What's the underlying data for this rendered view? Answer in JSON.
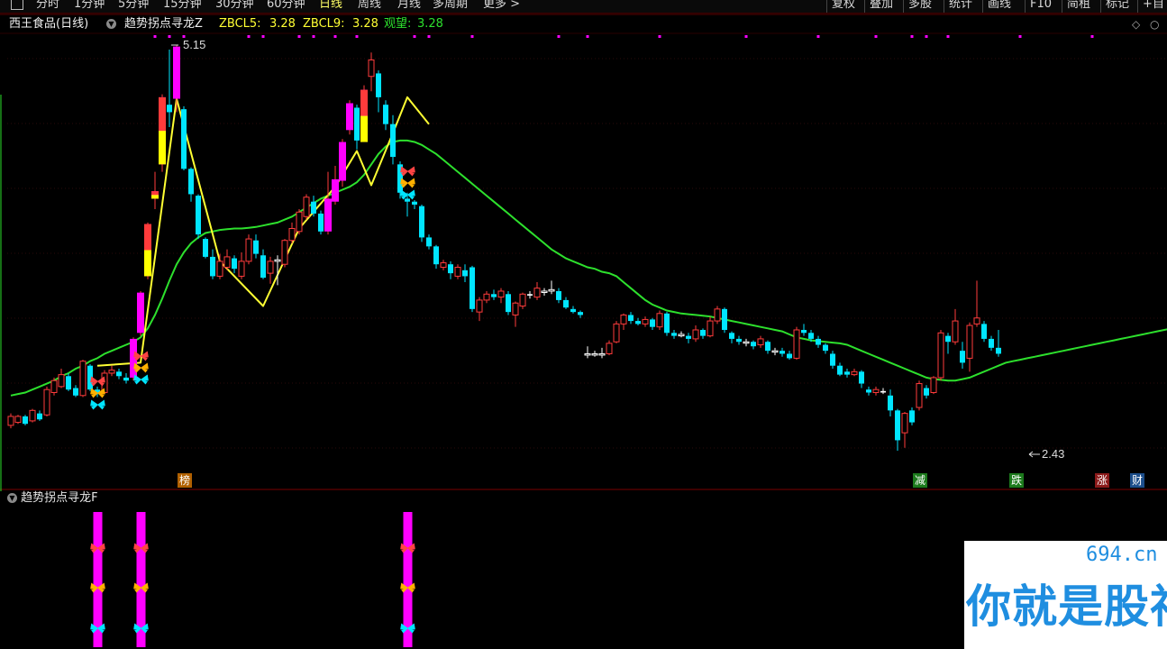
{
  "toolbar": {
    "left_items": [
      "分时",
      "1分钟",
      "5分钟",
      "15分钟",
      "30分钟",
      "60分钟",
      "日线",
      "周线",
      "月线",
      "多周期",
      "更多 >"
    ],
    "active_index": 6,
    "right_items": [
      "复权",
      "叠加",
      "多股",
      "统计",
      "画线",
      "F10",
      "简租",
      "标记",
      "+自"
    ]
  },
  "header": {
    "stock": "西王食品(日线)",
    "indicator": "趋势拐点寻龙Z",
    "zbcl5_label": "ZBCL5:",
    "zbcl5_value": "3.28",
    "zbcl9_label": "ZBCL9:",
    "zbcl9_value": "3.28",
    "watch_label": "观望:",
    "watch_value": "3.28"
  },
  "price_labels": {
    "high": "5.15",
    "low": "2.43"
  },
  "events": [
    {
      "label": "榜",
      "color": "#b06000"
    },
    {
      "label": "减",
      "color": "#1c7a1c"
    },
    {
      "label": "跌",
      "color": "#1c7a1c"
    },
    {
      "label": "涨",
      "color": "#8b1a1a"
    },
    {
      "label": "财",
      "color": "#1c4e8b"
    }
  ],
  "sub_panel": {
    "title": "趋势拐点寻龙F"
  },
  "colors": {
    "up": "#ff3b3b",
    "down": "#00e5ff",
    "ma": "#2de02d",
    "trend": "#ffff33",
    "signal": "#ff00ff"
  },
  "watermark": {
    "site": "694.cn",
    "text": "你就是股神"
  },
  "chart_data": {
    "type": "candlestick",
    "title": "",
    "y_range": [
      2.3,
      5.3
    ],
    "candles": [
      {
        "o": 2.6,
        "c": 2.66,
        "h": 2.68,
        "l": 2.58
      },
      {
        "o": 2.62,
        "c": 2.66,
        "h": 2.67,
        "l": 2.61
      },
      {
        "o": 2.66,
        "c": 2.61,
        "h": 2.67,
        "l": 2.6
      },
      {
        "o": 2.63,
        "c": 2.7,
        "h": 2.71,
        "l": 2.62
      },
      {
        "o": 2.68,
        "c": 2.64,
        "h": 2.7,
        "l": 2.63
      },
      {
        "o": 2.67,
        "c": 2.84,
        "h": 2.86,
        "l": 2.66
      },
      {
        "o": 2.82,
        "c": 2.9,
        "h": 2.92,
        "l": 2.8
      },
      {
        "o": 2.86,
        "c": 2.94,
        "h": 2.98,
        "l": 2.85
      },
      {
        "o": 2.93,
        "c": 2.84,
        "h": 2.95,
        "l": 2.83
      },
      {
        "o": 2.85,
        "c": 2.8,
        "h": 2.87,
        "l": 2.79
      },
      {
        "o": 2.8,
        "c": 3.03,
        "h": 3.04,
        "l": 2.79
      },
      {
        "o": 3.0,
        "c": 2.84,
        "h": 3.01,
        "l": 2.83
      },
      {
        "o": 2.84,
        "c": 2.81,
        "h": 2.86,
        "l": 2.79
      },
      {
        "o": 2.82,
        "c": 2.95,
        "h": 2.97,
        "l": 2.81
      },
      {
        "o": 2.95,
        "c": 2.97,
        "h": 3.0,
        "l": 2.93
      },
      {
        "o": 2.96,
        "c": 2.93,
        "h": 2.98,
        "l": 2.91
      },
      {
        "o": 2.92,
        "c": 2.9,
        "h": 2.95,
        "l": 2.88
      },
      {
        "o": 2.92,
        "c": 3.18,
        "h": 3.19,
        "l": 2.9
      },
      {
        "o": 3.22,
        "c": 3.49,
        "h": 3.5,
        "l": 3.2
      },
      {
        "o": 3.6,
        "c": 3.95,
        "h": 3.96,
        "l": 3.58
      },
      {
        "o": 4.12,
        "c": 4.17,
        "h": 4.3,
        "l": 4.05
      },
      {
        "o": 4.35,
        "c": 4.8,
        "h": 4.82,
        "l": 4.3
      },
      {
        "o": 4.75,
        "c": 4.7,
        "h": 5.12,
        "l": 4.6
      },
      {
        "o": 4.79,
        "c": 5.14,
        "h": 5.15,
        "l": 4.7
      },
      {
        "o": 4.72,
        "c": 4.32,
        "h": 4.74,
        "l": 4.31
      },
      {
        "o": 4.32,
        "c": 4.15,
        "h": 4.33,
        "l": 4.1
      },
      {
        "o": 4.14,
        "c": 3.88,
        "h": 4.15,
        "l": 3.85
      },
      {
        "o": 3.85,
        "c": 3.73,
        "h": 3.86,
        "l": 3.72
      },
      {
        "o": 3.73,
        "c": 3.6,
        "h": 3.78,
        "l": 3.58
      },
      {
        "o": 3.6,
        "c": 3.7,
        "h": 3.75,
        "l": 3.58
      },
      {
        "o": 3.66,
        "c": 3.73,
        "h": 3.78,
        "l": 3.64
      },
      {
        "o": 3.72,
        "c": 3.65,
        "h": 3.74,
        "l": 3.62
      },
      {
        "o": 3.6,
        "c": 3.7,
        "h": 3.76,
        "l": 3.58
      },
      {
        "o": 3.7,
        "c": 3.85,
        "h": 3.88,
        "l": 3.68
      },
      {
        "o": 3.84,
        "c": 3.75,
        "h": 3.88,
        "l": 3.72
      },
      {
        "o": 3.74,
        "c": 3.59,
        "h": 3.78,
        "l": 3.58
      },
      {
        "o": 3.62,
        "c": 3.7,
        "h": 3.73,
        "l": 3.55
      },
      {
        "o": 3.7,
        "c": 3.71,
        "h": 3.74,
        "l": 3.54
      },
      {
        "o": 3.68,
        "c": 3.84,
        "h": 3.85,
        "l": 3.66
      },
      {
        "o": 3.84,
        "c": 3.92,
        "h": 3.96,
        "l": 3.82
      },
      {
        "o": 3.9,
        "c": 4.03,
        "h": 4.05,
        "l": 3.88
      },
      {
        "o": 4.0,
        "c": 4.13,
        "h": 4.15,
        "l": 3.98
      },
      {
        "o": 4.1,
        "c": 4.02,
        "h": 4.14,
        "l": 4.0
      },
      {
        "o": 4.02,
        "c": 3.9,
        "h": 4.04,
        "l": 3.88
      },
      {
        "o": 3.9,
        "c": 4.12,
        "h": 4.3,
        "l": 3.88
      },
      {
        "o": 4.1,
        "c": 4.25,
        "h": 4.34,
        "l": 4.08
      },
      {
        "o": 4.24,
        "c": 4.5,
        "h": 4.52,
        "l": 4.2
      },
      {
        "o": 4.58,
        "c": 4.76,
        "h": 4.78,
        "l": 4.55
      },
      {
        "o": 4.73,
        "c": 4.51,
        "h": 4.75,
        "l": 4.45
      },
      {
        "o": 4.5,
        "c": 4.85,
        "h": 4.88,
        "l": 4.5
      },
      {
        "o": 4.94,
        "c": 5.05,
        "h": 5.1,
        "l": 4.84
      },
      {
        "o": 4.96,
        "c": 4.8,
        "h": 4.98,
        "l": 4.7
      },
      {
        "o": 4.75,
        "c": 4.62,
        "h": 4.78,
        "l": 4.58
      },
      {
        "o": 4.62,
        "c": 4.4,
        "h": 4.68,
        "l": 4.35
      },
      {
        "o": 4.35,
        "c": 4.16,
        "h": 4.37,
        "l": 4.12
      },
      {
        "o": 4.12,
        "c": 4.1,
        "h": 4.16,
        "l": 4.0
      },
      {
        "o": 4.1,
        "c": 4.08,
        "h": 4.11,
        "l": 4.05
      },
      {
        "o": 4.07,
        "c": 3.86,
        "h": 4.08,
        "l": 3.83
      },
      {
        "o": 3.86,
        "c": 3.8,
        "h": 3.88,
        "l": 3.78
      },
      {
        "o": 3.8,
        "c": 3.68,
        "h": 3.81,
        "l": 3.65
      },
      {
        "o": 3.66,
        "c": 3.69,
        "h": 3.71,
        "l": 3.64
      },
      {
        "o": 3.68,
        "c": 3.62,
        "h": 3.7,
        "l": 3.58
      },
      {
        "o": 3.6,
        "c": 3.66,
        "h": 3.68,
        "l": 3.58
      },
      {
        "o": 3.64,
        "c": 3.6,
        "h": 3.68,
        "l": 3.56
      },
      {
        "o": 3.66,
        "c": 3.38,
        "h": 3.67,
        "l": 3.36
      },
      {
        "o": 3.36,
        "c": 3.44,
        "h": 3.46,
        "l": 3.3
      },
      {
        "o": 3.44,
        "c": 3.48,
        "h": 3.5,
        "l": 3.42
      },
      {
        "o": 3.48,
        "c": 3.46,
        "h": 3.51,
        "l": 3.44
      },
      {
        "o": 3.46,
        "c": 3.5,
        "h": 3.52,
        "l": 3.42
      },
      {
        "o": 3.48,
        "c": 3.36,
        "h": 3.5,
        "l": 3.34
      },
      {
        "o": 3.34,
        "c": 3.42,
        "h": 3.43,
        "l": 3.26
      },
      {
        "o": 3.4,
        "c": 3.48,
        "h": 3.49,
        "l": 3.38
      },
      {
        "o": 3.48,
        "c": 3.47,
        "h": 3.5,
        "l": 3.45
      },
      {
        "o": 3.46,
        "c": 3.52,
        "h": 3.56,
        "l": 3.44
      },
      {
        "o": 3.5,
        "c": 3.5,
        "h": 3.52,
        "l": 3.47
      },
      {
        "o": 3.5,
        "c": 3.51,
        "h": 3.57,
        "l": 3.48
      },
      {
        "o": 3.5,
        "c": 3.44,
        "h": 3.52,
        "l": 3.42
      },
      {
        "o": 3.44,
        "c": 3.39,
        "h": 3.46,
        "l": 3.38
      },
      {
        "o": 3.38,
        "c": 3.36,
        "h": 3.4,
        "l": 3.35
      },
      {
        "o": 3.36,
        "c": 3.34,
        "h": 3.37,
        "l": 3.32
      },
      {
        "o": 3.08,
        "c": 3.08,
        "h": 3.13,
        "l": 3.05
      },
      {
        "o": 3.08,
        "c": 3.08,
        "h": 3.1,
        "l": 3.06
      },
      {
        "o": 3.08,
        "c": 3.08,
        "h": 3.12,
        "l": 3.05
      },
      {
        "o": 3.08,
        "c": 3.15,
        "h": 3.17,
        "l": 3.07
      },
      {
        "o": 3.16,
        "c": 3.28,
        "h": 3.3,
        "l": 3.15
      },
      {
        "o": 3.28,
        "c": 3.34,
        "h": 3.35,
        "l": 3.24
      },
      {
        "o": 3.34,
        "c": 3.3,
        "h": 3.36,
        "l": 3.28
      },
      {
        "o": 3.3,
        "c": 3.28,
        "h": 3.32,
        "l": 3.27
      },
      {
        "o": 3.28,
        "c": 3.31,
        "h": 3.33,
        "l": 3.26
      },
      {
        "o": 3.31,
        "c": 3.26,
        "h": 3.32,
        "l": 3.24
      },
      {
        "o": 3.26,
        "c": 3.35,
        "h": 3.37,
        "l": 3.24
      },
      {
        "o": 3.35,
        "c": 3.22,
        "h": 3.36,
        "l": 3.2
      },
      {
        "o": 3.22,
        "c": 3.2,
        "h": 3.24,
        "l": 3.18
      },
      {
        "o": 3.2,
        "c": 3.21,
        "h": 3.23,
        "l": 3.19
      },
      {
        "o": 3.2,
        "c": 3.18,
        "h": 3.22,
        "l": 3.15
      },
      {
        "o": 3.18,
        "c": 3.24,
        "h": 3.27,
        "l": 3.16
      },
      {
        "o": 3.24,
        "c": 3.2,
        "h": 3.25,
        "l": 3.18
      },
      {
        "o": 3.2,
        "c": 3.3,
        "h": 3.33,
        "l": 3.19
      },
      {
        "o": 3.3,
        "c": 3.38,
        "h": 3.4,
        "l": 3.28
      },
      {
        "o": 3.38,
        "c": 3.24,
        "h": 3.39,
        "l": 3.22
      },
      {
        "o": 3.22,
        "c": 3.18,
        "h": 3.23,
        "l": 3.15
      },
      {
        "o": 3.18,
        "c": 3.16,
        "h": 3.2,
        "l": 3.14
      },
      {
        "o": 3.16,
        "c": 3.16,
        "h": 3.18,
        "l": 3.13
      },
      {
        "o": 3.16,
        "c": 3.13,
        "h": 3.17,
        "l": 3.11
      },
      {
        "o": 3.14,
        "c": 3.18,
        "h": 3.2,
        "l": 3.12
      },
      {
        "o": 3.16,
        "c": 3.1,
        "h": 3.17,
        "l": 3.08
      },
      {
        "o": 3.1,
        "c": 3.1,
        "h": 3.12,
        "l": 3.07
      },
      {
        "o": 3.1,
        "c": 3.08,
        "h": 3.12,
        "l": 3.06
      },
      {
        "o": 3.08,
        "c": 3.05,
        "h": 3.1,
        "l": 3.04
      },
      {
        "o": 3.05,
        "c": 3.24,
        "h": 3.26,
        "l": 3.04
      },
      {
        "o": 3.24,
        "c": 3.22,
        "h": 3.28,
        "l": 3.2
      },
      {
        "o": 3.22,
        "c": 3.18,
        "h": 3.24,
        "l": 3.16
      },
      {
        "o": 3.18,
        "c": 3.14,
        "h": 3.2,
        "l": 3.12
      },
      {
        "o": 3.14,
        "c": 3.1,
        "h": 3.15,
        "l": 3.08
      },
      {
        "o": 3.08,
        "c": 3.0,
        "h": 3.1,
        "l": 2.98
      },
      {
        "o": 3.0,
        "c": 2.94,
        "h": 3.02,
        "l": 2.93
      },
      {
        "o": 2.96,
        "c": 2.94,
        "h": 2.98,
        "l": 2.92
      },
      {
        "o": 2.94,
        "c": 2.96,
        "h": 2.98,
        "l": 2.93
      },
      {
        "o": 2.96,
        "c": 2.88,
        "h": 2.97,
        "l": 2.85
      },
      {
        "o": 2.84,
        "c": 2.82,
        "h": 2.86,
        "l": 2.8
      },
      {
        "o": 2.82,
        "c": 2.84,
        "h": 2.86,
        "l": 2.8
      },
      {
        "o": 2.83,
        "c": 2.82,
        "h": 2.85,
        "l": 2.81
      },
      {
        "o": 2.8,
        "c": 2.7,
        "h": 2.84,
        "l": 2.66
      },
      {
        "o": 2.7,
        "c": 2.5,
        "h": 2.71,
        "l": 2.43
      },
      {
        "o": 2.55,
        "c": 2.68,
        "h": 2.69,
        "l": 2.45
      },
      {
        "o": 2.7,
        "c": 2.62,
        "h": 2.72,
        "l": 2.6
      },
      {
        "o": 2.72,
        "c": 2.88,
        "h": 2.9,
        "l": 2.7
      },
      {
        "o": 2.85,
        "c": 2.8,
        "h": 2.87,
        "l": 2.78
      },
      {
        "o": 2.82,
        "c": 2.92,
        "h": 2.93,
        "l": 2.81
      },
      {
        "o": 2.92,
        "c": 3.22,
        "h": 3.24,
        "l": 2.9
      },
      {
        "o": 3.2,
        "c": 3.16,
        "h": 3.22,
        "l": 3.08
      },
      {
        "o": 3.16,
        "c": 3.3,
        "h": 3.38,
        "l": 3.14
      },
      {
        "o": 3.1,
        "c": 3.02,
        "h": 3.16,
        "l": 2.98
      },
      {
        "o": 3.05,
        "c": 3.27,
        "h": 3.29,
        "l": 2.96
      },
      {
        "o": 3.28,
        "c": 3.32,
        "h": 3.57,
        "l": 3.26
      },
      {
        "o": 3.28,
        "c": 3.18,
        "h": 3.3,
        "l": 3.16
      },
      {
        "o": 3.18,
        "c": 3.12,
        "h": 3.2,
        "l": 3.1
      },
      {
        "o": 3.12,
        "c": 3.08,
        "h": 3.24,
        "l": 3.06
      }
    ],
    "ma": [
      2.8,
      2.81,
      2.82,
      2.84,
      2.86,
      2.88,
      2.9,
      2.93,
      2.95,
      2.98,
      3.0,
      3.03,
      3.05,
      3.08,
      3.1,
      3.12,
      3.14,
      3.16,
      3.19,
      3.25,
      3.34,
      3.45,
      3.57,
      3.68,
      3.76,
      3.82,
      3.86,
      3.89,
      3.9,
      3.91,
      3.915,
      3.92,
      3.92,
      3.925,
      3.93,
      3.94,
      3.95,
      3.96,
      3.98,
      4.0,
      4.03,
      4.06,
      4.09,
      4.12,
      4.14,
      4.16,
      4.18,
      4.2,
      4.23,
      4.28,
      4.35,
      4.42,
      4.47,
      4.5,
      4.51,
      4.51,
      4.5,
      4.48,
      4.45,
      4.42,
      4.38,
      4.34,
      4.3,
      4.26,
      4.22,
      4.18,
      4.14,
      4.1,
      4.06,
      4.02,
      3.98,
      3.94,
      3.9,
      3.86,
      3.82,
      3.78,
      3.75,
      3.72,
      3.7,
      3.68,
      3.66,
      3.65,
      3.63,
      3.62,
      3.6,
      3.56,
      3.52,
      3.48,
      3.44,
      3.41,
      3.39,
      3.37,
      3.36,
      3.35,
      3.345,
      3.34,
      3.335,
      3.33,
      3.32,
      3.31,
      3.3,
      3.29,
      3.28,
      3.27,
      3.26,
      3.25,
      3.24,
      3.23,
      3.21,
      3.19,
      3.18,
      3.17,
      3.165,
      3.16,
      3.155,
      3.15,
      3.14,
      3.12,
      3.1,
      3.08,
      3.06,
      3.04,
      3.02,
      3.0,
      2.98,
      2.96,
      2.94,
      2.92,
      2.91,
      2.905,
      2.9,
      2.9,
      2.91,
      2.92,
      2.94,
      2.96,
      2.98,
      3.0,
      3.02,
      3.03,
      3.04,
      3.05,
      3.06,
      3.07,
      3.08,
      3.09,
      3.1,
      3.11,
      3.12,
      3.13,
      3.14,
      3.15,
      3.16,
      3.17,
      3.18,
      3.19,
      3.2,
      3.21,
      3.22,
      3.23,
      3.24,
      3.25,
      3.26,
      3.27,
      3.28,
      3.29,
      3.3,
      3.3
    ],
    "trend": [
      [
        12,
        3.0
      ],
      [
        18,
        3.02
      ],
      [
        23,
        4.79
      ],
      [
        29,
        3.7
      ],
      [
        35,
        3.4
      ],
      [
        40,
        3.92
      ],
      [
        45,
        4.2
      ],
      [
        48,
        4.44
      ],
      [
        50,
        4.21
      ],
      [
        53,
        4.56
      ],
      [
        55,
        4.8
      ],
      [
        58,
        4.62
      ]
    ],
    "signals_top": [
      20,
      22,
      24,
      33,
      35,
      40,
      42,
      45,
      48,
      56,
      58,
      64,
      76,
      80,
      90,
      102,
      112,
      120,
      125,
      127,
      130,
      140,
      150
    ],
    "signals_main": [
      12,
      18,
      55
    ],
    "signals_sub": [
      12,
      18,
      55
    ]
  }
}
